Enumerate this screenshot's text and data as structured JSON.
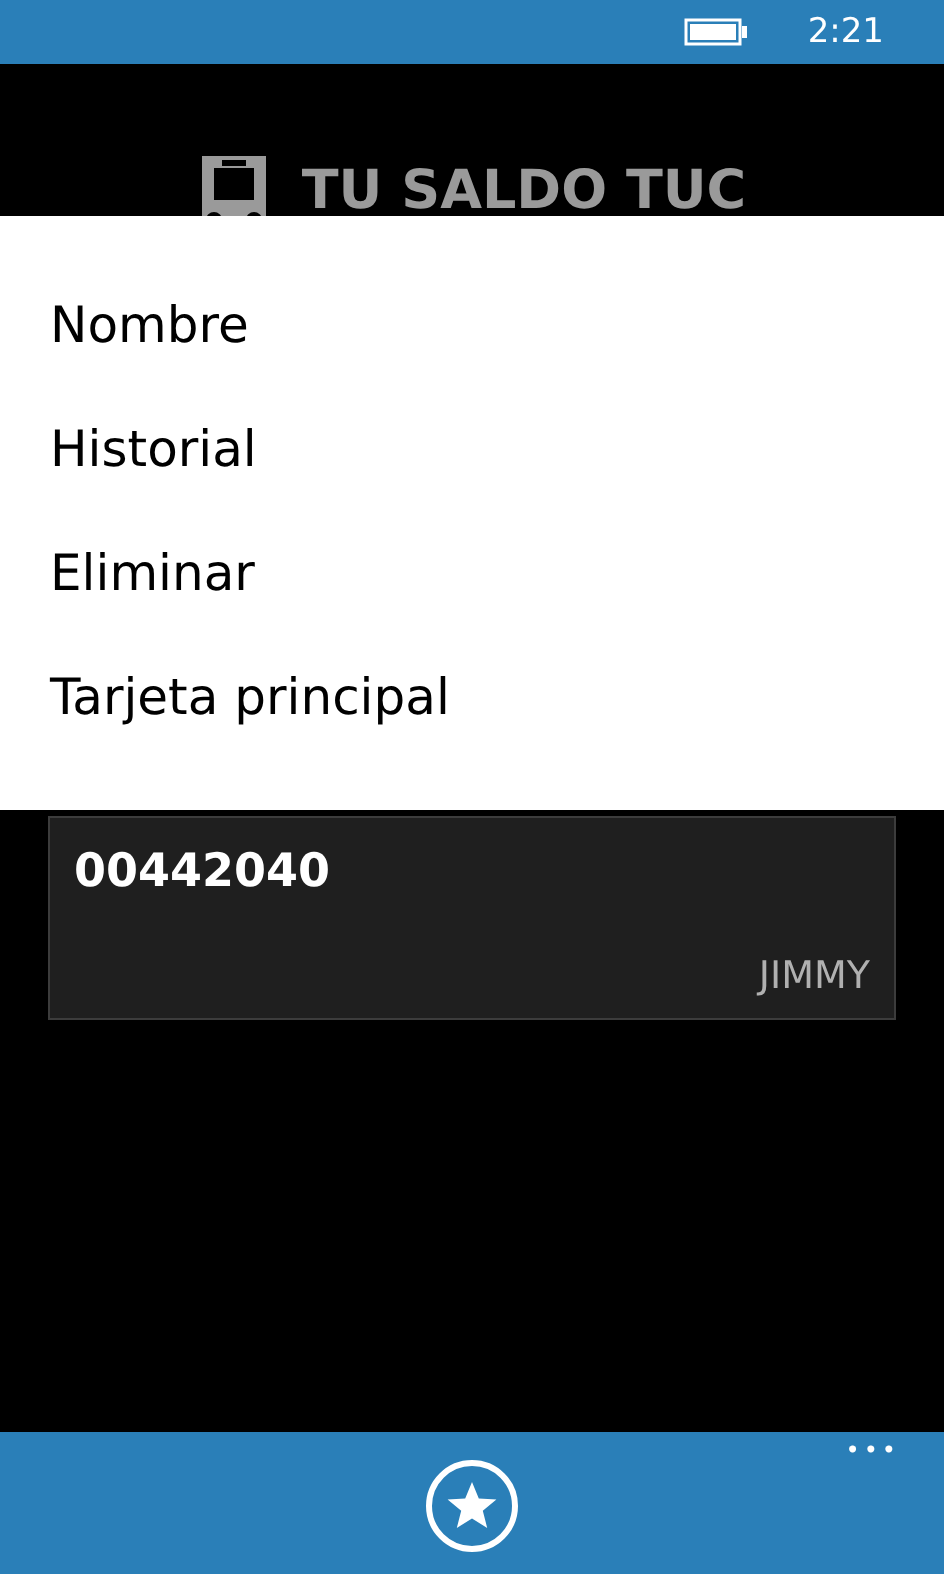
{
  "status_bar": {
    "time": "2:21"
  },
  "header": {
    "title": "TU SALDO TUC"
  },
  "context_menu": {
    "items": [
      {
        "label": "Nombre"
      },
      {
        "label": "Historial"
      },
      {
        "label": "Eliminar"
      },
      {
        "label": "Tarjeta principal"
      }
    ]
  },
  "cards": [
    {
      "number": "00442040",
      "name": "JIMMY"
    }
  ],
  "app_bar": {
    "more": "•••"
  }
}
